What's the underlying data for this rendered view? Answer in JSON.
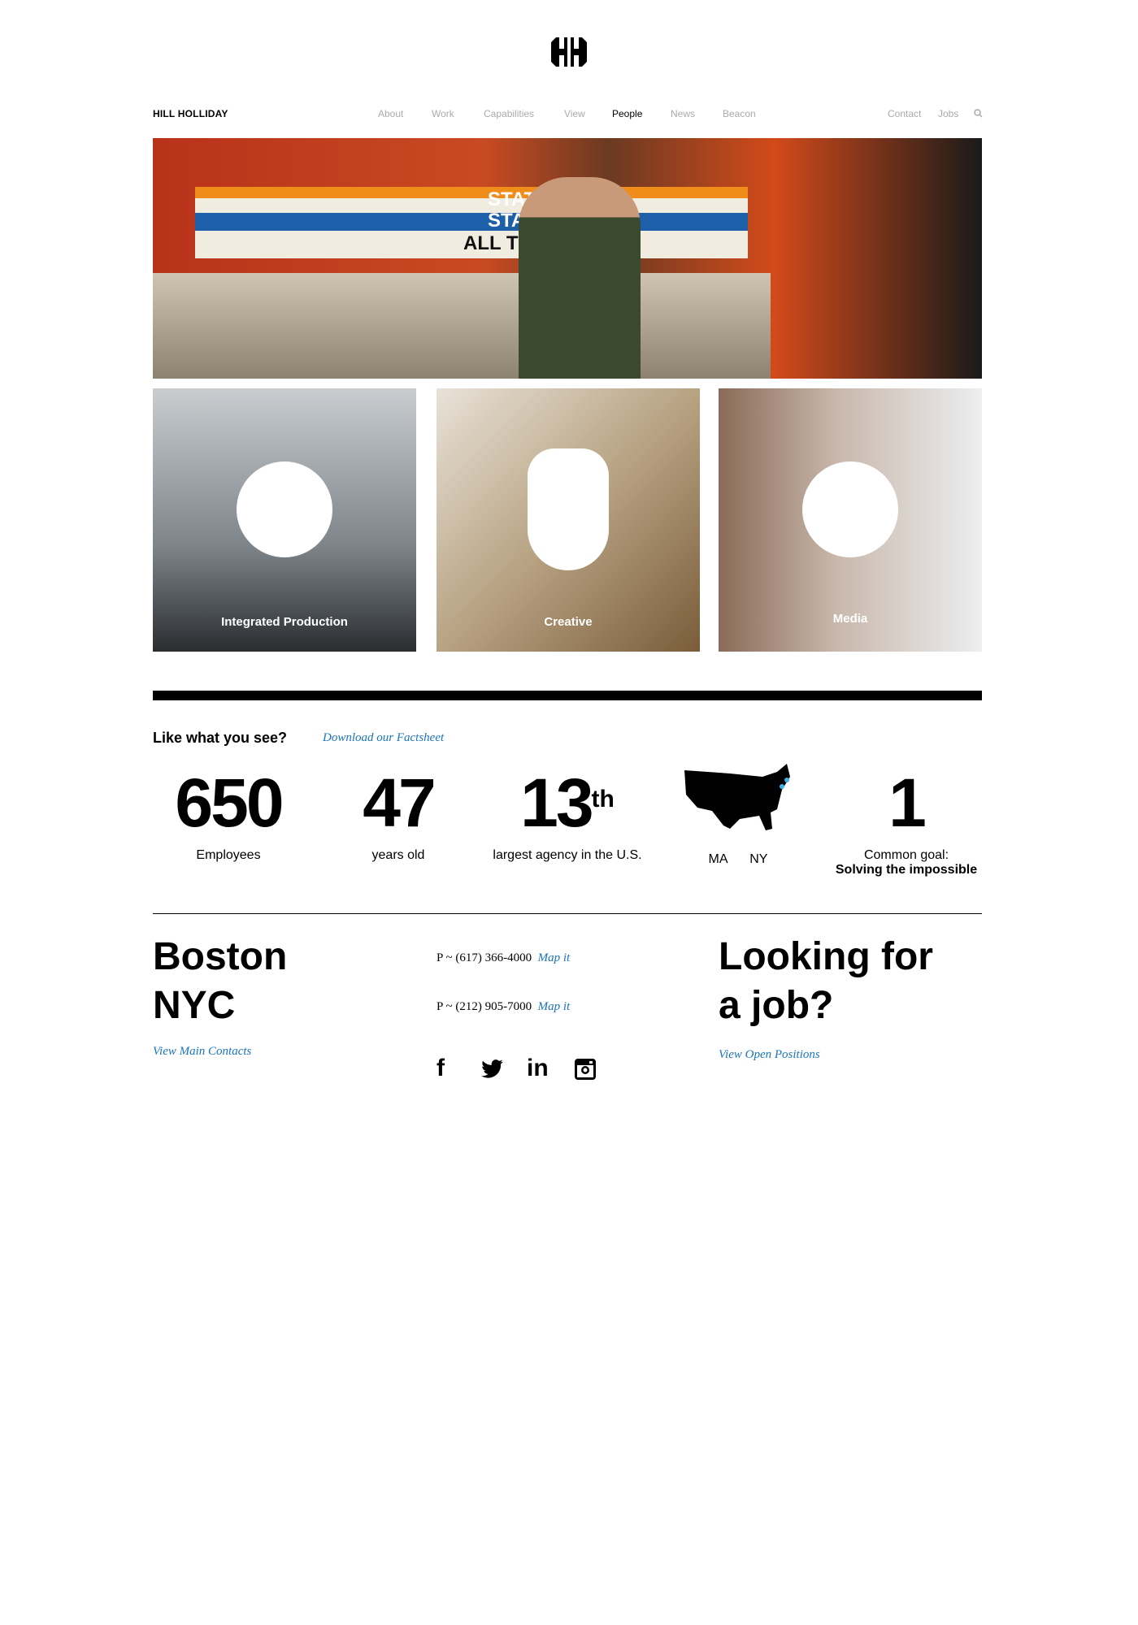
{
  "header": {
    "brand": "HILL HOLLIDAY",
    "logo": "HH",
    "nav": [
      "About",
      "Work",
      "Capabilities",
      "View",
      "People",
      "News",
      "Beacon"
    ],
    "active": "People",
    "right_nav": [
      "Contact",
      "Jobs"
    ],
    "search_icon": "search-icon"
  },
  "tiles": [
    {
      "label": "Integrated Production"
    },
    {
      "label": "Creative"
    },
    {
      "label": "Media"
    }
  ],
  "hero": {
    "sign": [
      "STATE",
      "STATE",
      "ALL TRAIN"
    ]
  },
  "stats": {
    "heading": "Like what you see?",
    "link": "Download our Factsheet",
    "items": [
      {
        "num": "650",
        "label": "Employees"
      },
      {
        "num": "47",
        "label": "years old"
      },
      {
        "num": "13",
        "sup": "th",
        "label": "largest agency in the U.S."
      },
      {
        "label_a": "MA",
        "label_b": "NY"
      },
      {
        "num": "1",
        "label": "Common goal:",
        "label2": "Solving the impossible"
      }
    ],
    "accent": "#3fb0e8"
  },
  "contact": {
    "city1": "Boston",
    "city2": "NYC",
    "view_contacts": "View Main Contacts",
    "phone1": "P ~ (617) 366-4000",
    "phone2": "P ~ (212) 905-7000",
    "map": "Map it",
    "social": [
      "facebook-icon",
      "twitter-icon",
      "linkedin-icon",
      "instagram-icon"
    ],
    "jobs1": "Looking for",
    "jobs2": "a job?",
    "jobs_link": "View Open Positions"
  },
  "link_color": "#1a75bb"
}
